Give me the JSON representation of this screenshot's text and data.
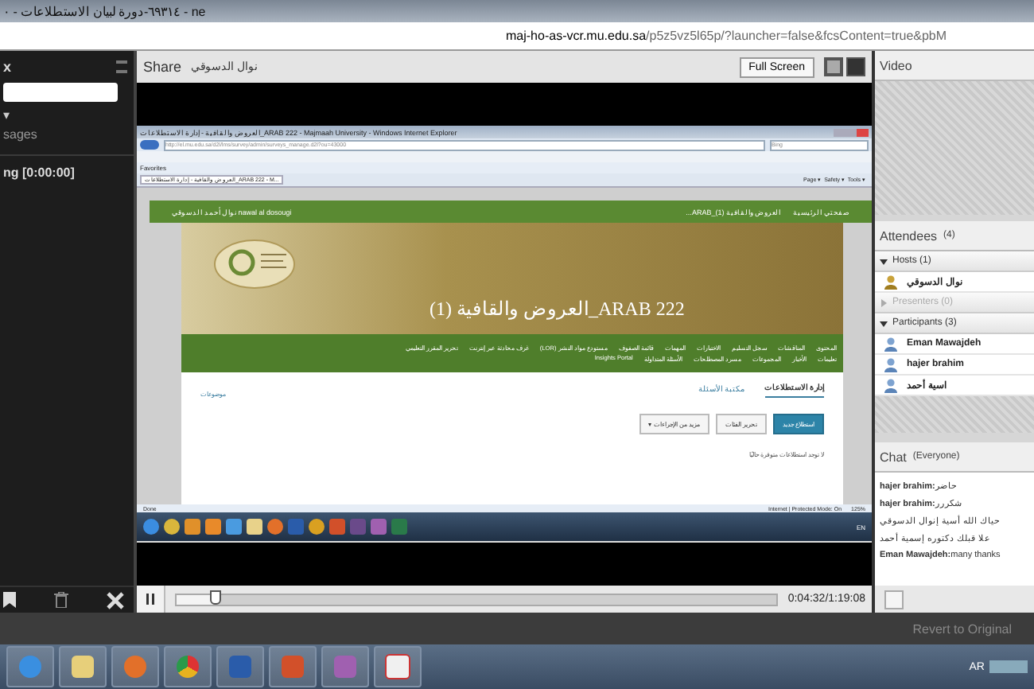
{
  "window": {
    "title": "٦٩٣١٤-دورة لبيان الاستطلاعات - ٠ - ne",
    "url_host": "maj-ho-as-vcr.mu.edu.sa",
    "url_path": "/p5z5vz5l65p/?launcher=false&fcsContent=true&pbM"
  },
  "left_pod": {
    "title": "x",
    "caret": "▾",
    "messages_label": "sages",
    "recording": "ng [0:00:00]"
  },
  "share_pod": {
    "title": "Share",
    "presenter": "نوال الدسوقي",
    "full_screen": "Full Screen",
    "shared_screen": {
      "title": "العروض والقافية - إدارة الاستطلاعات_ARAB 222 - Majmaah University - Windows Internet Explorer",
      "address": "http://el.mu.edu.sa/d2l/lms/survey/admin/surveys_manage.d2l?ou=43000",
      "search": "Bing",
      "favorites": "Favorites",
      "tab": "العروض والقافية - إدارة الاستطلاعات_ARAB 222 - M...",
      "commands": "Page ▾  Safety ▾  Tools ▾",
      "nav": {
        "home": "صفحتي الرئيسية",
        "course": "العروض والقافية (1)_ARAB...",
        "user": "nawal al dosougi نوال أحمد الدسوقي"
      },
      "course_title": "العروض والقافية (1)_ARAB 222",
      "menu_rows": [
        [
          "المحتوى",
          "المناقشات",
          "سجل التسليم",
          "الاختبارات",
          "المهمات",
          "قائمة الصفوف",
          "مستودع مواد النشر (LOR)",
          "غرف محادثة عبر إنترنت",
          "تحرير المقرر التعليمي"
        ],
        [
          "تعليمات",
          "الأخبار",
          "المجموعات",
          "مسرد المصطلحات",
          "الأسئلة المتداولة",
          "Insights Portal"
        ]
      ],
      "tabs": [
        {
          "label": "إدارة الاستطلاعات",
          "selected": true
        },
        {
          "label": "مكتبة الأسئلة",
          "selected": false
        }
      ],
      "help": "موضوعات",
      "buttons": [
        {
          "label": "استطلاع جديد",
          "kind": "primary"
        },
        {
          "label": "تحرير الفئات",
          "kind": "plain"
        },
        {
          "label": "مزيد من الإجراءات ▾",
          "kind": "plain"
        }
      ],
      "empty_text": "لا توجد استطلاعات متوفرة حاليًا",
      "status": {
        "left": "Done",
        "zone": "Internet | Protected Mode: On",
        "zoom": "125%"
      },
      "tray": "EN"
    },
    "player": {
      "level": 0.06,
      "time": "0:04:32/1:19:08"
    }
  },
  "video_pod": {
    "title": "Video"
  },
  "attendees": {
    "title": "Attendees",
    "count": "(4)",
    "groups": [
      {
        "label": "Hosts (1)",
        "expanded": true,
        "people": [
          {
            "name": "نوال الدسوقي",
            "kind": "host"
          }
        ]
      },
      {
        "label": "Presenters (0)",
        "expanded": false
      },
      {
        "label": "Participants (3)",
        "expanded": true,
        "people": [
          {
            "name": "Eman Mawajdeh",
            "kind": "participant"
          },
          {
            "name": "hajer brahim",
            "kind": "participant"
          },
          {
            "name": "اسية أحمد",
            "kind": "participant"
          }
        ]
      }
    ]
  },
  "chat": {
    "title": "Chat",
    "scope": "(Everyone)",
    "messages": [
      {
        "sender": "hajer brahim:",
        "text": "حاضر"
      },
      {
        "sender": "hajer brahim:",
        "text": "شكررر"
      },
      {
        "text": "حياك الله أسية إنوال الدسوقي"
      },
      {
        "text": "علا قبلك دكتوره إسمية أحمد"
      },
      {
        "sender": "Eman Mawajdeh:",
        "text": "many thanks"
      }
    ]
  },
  "bottom_bar": {
    "revert": "Revert to Original"
  },
  "taskbar": {
    "language": "AR"
  }
}
